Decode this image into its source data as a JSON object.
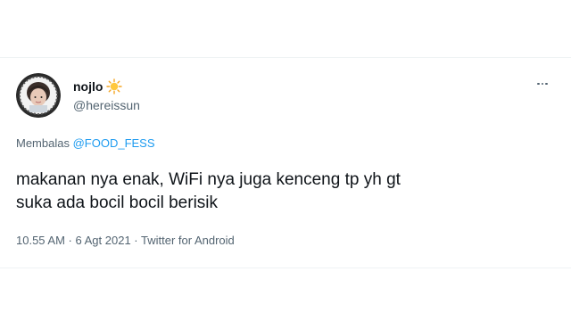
{
  "tweet": {
    "display_name": "nojlo",
    "name_emoji": "sun-emoji",
    "handle": "@hereissun",
    "reply_prefix": "Membalas",
    "reply_to": "@FOOD_FESS",
    "text_lines": [
      "makanan nya enak, WiFi nya juga kenceng tp yh gt",
      "suka ada bocil bocil berisik"
    ],
    "time": "10.55 AM",
    "date": "6 Agt 2021",
    "source": "Twitter for Android",
    "separator": " · ",
    "more_icon": "more-horizontal-icon"
  },
  "colors": {
    "text_primary": "#0f1419",
    "text_secondary": "#536471",
    "link": "#1d9bf0",
    "divider": "#eff3f4"
  }
}
